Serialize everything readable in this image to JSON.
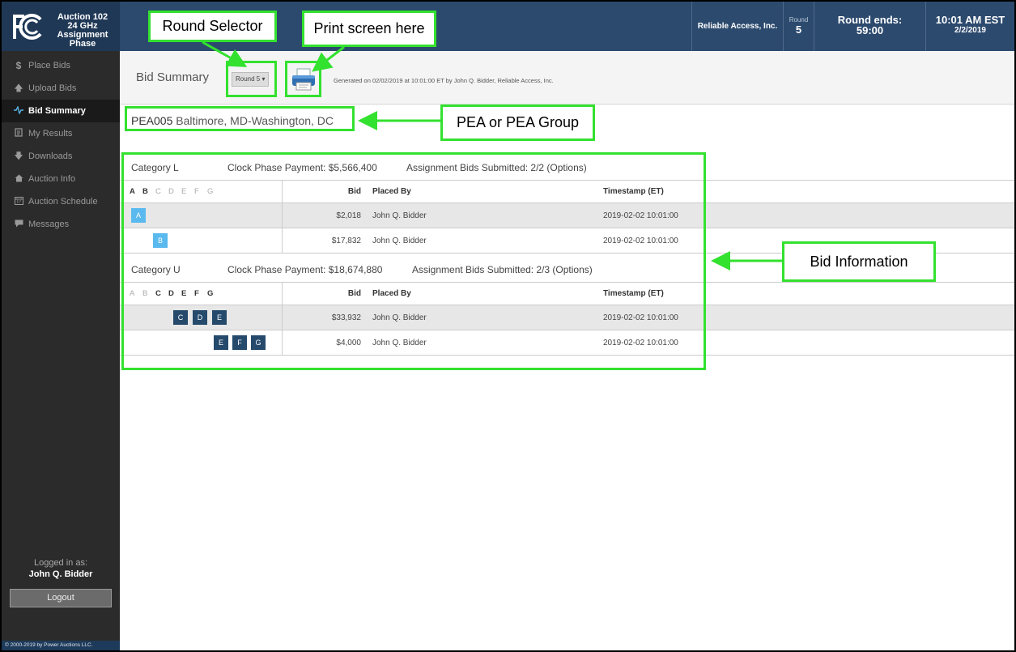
{
  "header": {
    "app_title": "Auction 102\n24 GHz\nAssignment Phase",
    "company": "Reliable Access, Inc.",
    "round_label": "Round",
    "round_value": "5",
    "round_ends_label": "Round ends:",
    "round_ends_value": "59:00",
    "time": "10:01 AM EST",
    "date": "2/2/2019",
    "brand_color": "#2c4a6e"
  },
  "sidebar": {
    "items": [
      {
        "label": "Place Bids",
        "icon": "dollar-icon"
      },
      {
        "label": "Upload Bids",
        "icon": "upload-arrow-icon"
      },
      {
        "label": "Bid Summary",
        "icon": "pulse-icon"
      },
      {
        "label": "My Results",
        "icon": "document-icon"
      },
      {
        "label": "Downloads",
        "icon": "download-arrow-icon"
      },
      {
        "label": "Auction Info",
        "icon": "home-icon"
      },
      {
        "label": "Auction Schedule",
        "icon": "calendar-icon"
      },
      {
        "label": "Messages",
        "icon": "chat-icon"
      }
    ],
    "active": "Bid Summary",
    "logged_in_label": "Logged in as:",
    "user": "John Q. Bidder",
    "logout": "Logout",
    "copyright": "© 2000-2019 by Power Auctions LLC."
  },
  "summary": {
    "title": "Bid Summary",
    "round_select": "Round 5 ▾",
    "generated": "Generated on 02/02/2019 at 10:01:00 ET by John Q. Bidder, Reliable Access, Inc."
  },
  "pea": {
    "code": "PEA005",
    "name": "Baltimore, MD-Washington, DC"
  },
  "columns": {
    "letters": [
      "A",
      "B",
      "C",
      "D",
      "E",
      "F",
      "G"
    ],
    "bid": "Bid",
    "placed_by": "Placed By",
    "timestamp": "Timestamp (ET)"
  },
  "categories": [
    {
      "name": "Category L",
      "clock_payment": "Clock Phase Payment: $5,566,400",
      "submitted": "Assignment Bids Submitted: 2/2 (Options)",
      "rows": [
        {
          "chips": [
            "A"
          ],
          "bid": "$2,018",
          "by": "John Q. Bidder",
          "ts": "2019-02-02 10:01:00"
        },
        {
          "chips": [
            "B"
          ],
          "bid": "$17,832",
          "by": "John Q. Bidder",
          "ts": "2019-02-02 10:01:00"
        }
      ]
    },
    {
      "name": "Category U",
      "clock_payment": "Clock Phase Payment: $18,674,880",
      "submitted": "Assignment Bids Submitted: 2/3 (Options)",
      "rows": [
        {
          "chips": [
            "C",
            "D",
            "E"
          ],
          "bid": "$33,932",
          "by": "John Q. Bidder",
          "ts": "2019-02-02 10:01:00"
        },
        {
          "chips": [
            "E",
            "F",
            "G"
          ],
          "bid": "$4,000",
          "by": "John Q. Bidder",
          "ts": "2019-02-02 10:01:00"
        }
      ]
    }
  ],
  "callouts": {
    "round_selector": "Round Selector",
    "print": "Print screen here",
    "pea": "PEA or PEA Group",
    "bid_info": "Bid Information",
    "color": "#33e12f"
  }
}
